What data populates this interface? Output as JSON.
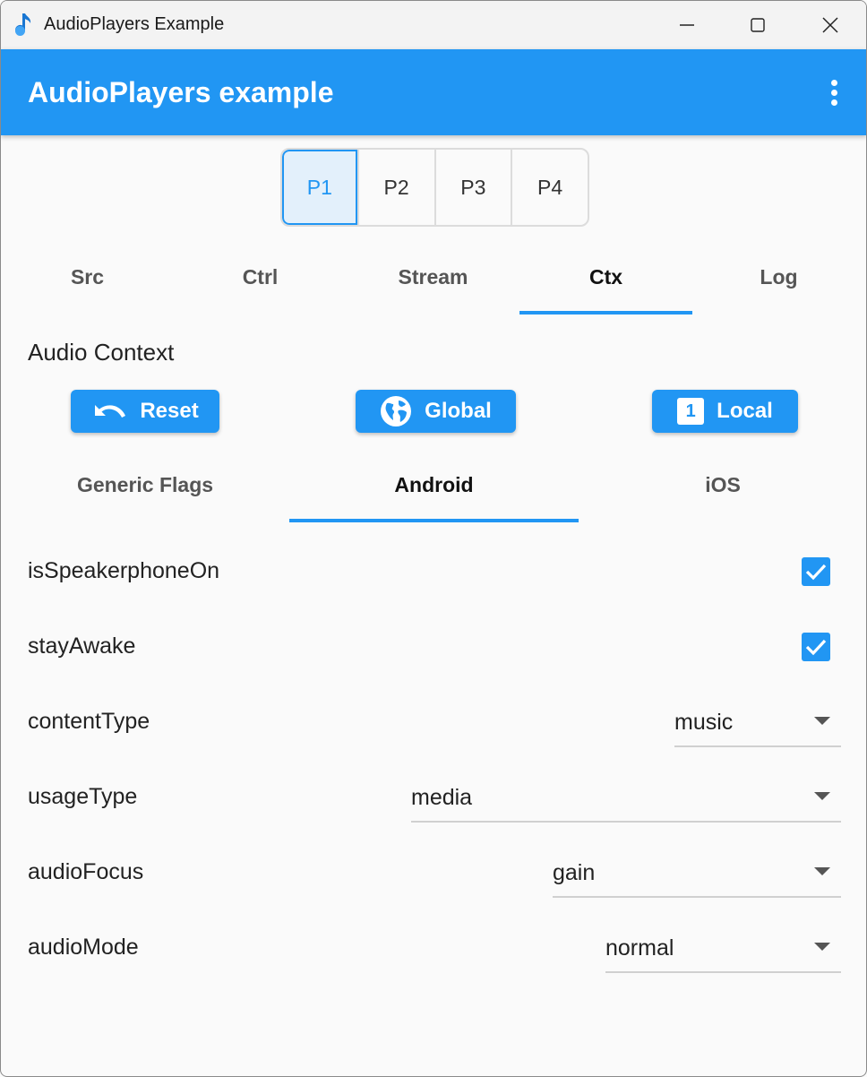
{
  "window": {
    "title": "AudioPlayers Example"
  },
  "appbar": {
    "title": "AudioPlayers example"
  },
  "players": [
    "P1",
    "P2",
    "P3",
    "P4"
  ],
  "tabs": [
    "Src",
    "Ctrl",
    "Stream",
    "Ctx",
    "Log"
  ],
  "section": {
    "title": "Audio Context"
  },
  "actions": {
    "reset": "Reset",
    "global": "Global",
    "local": "Local",
    "local_icon_number": "1"
  },
  "subtabs": [
    "Generic Flags",
    "Android",
    "iOS"
  ],
  "settings": {
    "isSpeakerphoneOn": {
      "label": "isSpeakerphoneOn",
      "checked": true
    },
    "stayAwake": {
      "label": "stayAwake",
      "checked": true
    },
    "contentType": {
      "label": "contentType",
      "value": "music"
    },
    "usageType": {
      "label": "usageType",
      "value": "media"
    },
    "audioFocus": {
      "label": "audioFocus",
      "value": "gain"
    },
    "audioMode": {
      "label": "audioMode",
      "value": "normal"
    }
  },
  "colors": {
    "primary": "#2196f3",
    "background": "#fafafa",
    "titlebar": "#f3f3f3"
  }
}
